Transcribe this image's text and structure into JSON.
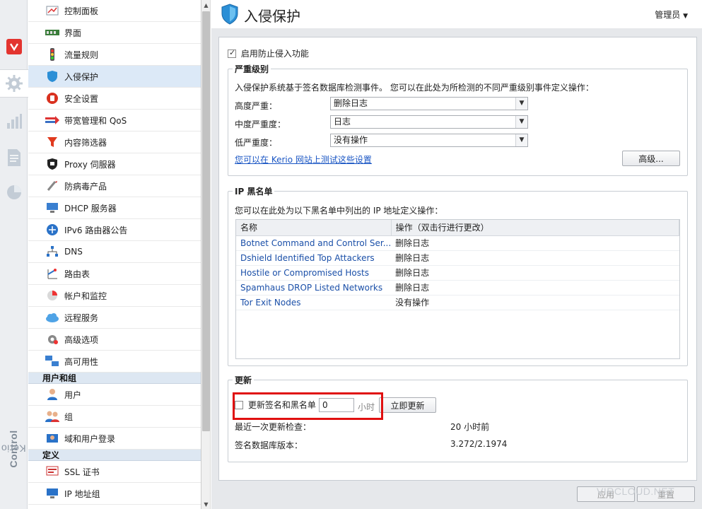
{
  "brand": {
    "prefix": "Kerio",
    "suffix": "Control"
  },
  "nav": {
    "items": [
      {
        "label": "控制面板",
        "icon": "dashboard-icon"
      },
      {
        "label": "界面",
        "icon": "interfaces-icon"
      },
      {
        "label": "流量规则",
        "icon": "traffic-light-icon"
      },
      {
        "label": "入侵保护",
        "icon": "shield-icon"
      },
      {
        "label": "安全设置",
        "icon": "hand-stop-icon"
      },
      {
        "label": "带宽管理和 QoS",
        "icon": "bandwidth-icon"
      },
      {
        "label": "内容筛选器",
        "icon": "filter-icon"
      },
      {
        "label": "Proxy 伺服器",
        "icon": "proxy-server-icon"
      },
      {
        "label": "防病毒产品",
        "icon": "antivirus-icon"
      },
      {
        "label": "DHCP 服务器",
        "icon": "dhcp-icon"
      },
      {
        "label": "IPv6 路由器公告",
        "icon": "ipv6-router-icon"
      },
      {
        "label": "DNS",
        "icon": "dns-icon"
      },
      {
        "label": "路由表",
        "icon": "routing-table-icon"
      },
      {
        "label": "帐户和监控",
        "icon": "accounting-icon"
      },
      {
        "label": "远程服务",
        "icon": "cloud-icon"
      },
      {
        "label": "高级选项",
        "icon": "advanced-options-icon"
      },
      {
        "label": "高可用性",
        "icon": "high-availability-icon"
      }
    ],
    "group_users": "用户和组",
    "users_items": [
      {
        "label": "用户",
        "icon": "user-icon"
      },
      {
        "label": "组",
        "icon": "group-icon"
      },
      {
        "label": "域和用户登录",
        "icon": "domain-login-icon"
      }
    ],
    "group_definitions": "定义",
    "def_items": [
      {
        "label": "SSL 证书",
        "icon": "ssl-certificate-icon"
      },
      {
        "label": "IP 地址组",
        "icon": "ip-group-icon"
      }
    ]
  },
  "header": {
    "title": "入侵保护",
    "user": "管理员"
  },
  "enable_ips": {
    "label": "启用防止侵入功能",
    "checked": true
  },
  "severity": {
    "legend": "严重级别",
    "description": "入侵保护系统基于签名数据库检测事件。 您可以在此处为所检测的不同严重级别事件定义操作：",
    "high_label": "高度严重：",
    "high_value": "删除日志",
    "medium_label": "中度严重度：",
    "medium_value": "日志",
    "low_label": "低严重度：",
    "low_value": "没有操作",
    "test_link": "您可以在 Kerio 网站上测试这些设置",
    "advanced_button": "高级..."
  },
  "blacklist": {
    "legend": "IP 黑名单",
    "description": "您可以在此处为以下黑名单中列出的 IP 地址定义操作：",
    "col_name": "名称",
    "col_action": "操作（双击行进行更改）",
    "rows": [
      {
        "name": "Botnet Command and Control Ser...",
        "action": "删除日志"
      },
      {
        "name": "Dshield Identified Top Attackers",
        "action": "删除日志"
      },
      {
        "name": "Hostile or Compromised Hosts",
        "action": "删除日志"
      },
      {
        "name": "Spamhaus DROP Listed Networks",
        "action": "删除日志"
      },
      {
        "name": "Tor Exit Nodes",
        "action": "没有操作"
      }
    ]
  },
  "update": {
    "legend": "更新",
    "checkbox_label": "更新签名和黑名单",
    "interval_value": "0",
    "interval_unit": "小时",
    "update_now_button": "立即更新",
    "last_check_label": "最近一次更新检查：",
    "last_check_value": "20 小时前",
    "db_version_label": "签名数据库版本：",
    "db_version_value": "3.272/2.1974"
  },
  "footer": {
    "apply": "应用",
    "reset": "重置",
    "watermark": "VIRCLOUD.NET"
  },
  "colors": {
    "accent": "#1a56c4",
    "highlight": "#e01010",
    "brand_red": "#e3342f"
  }
}
